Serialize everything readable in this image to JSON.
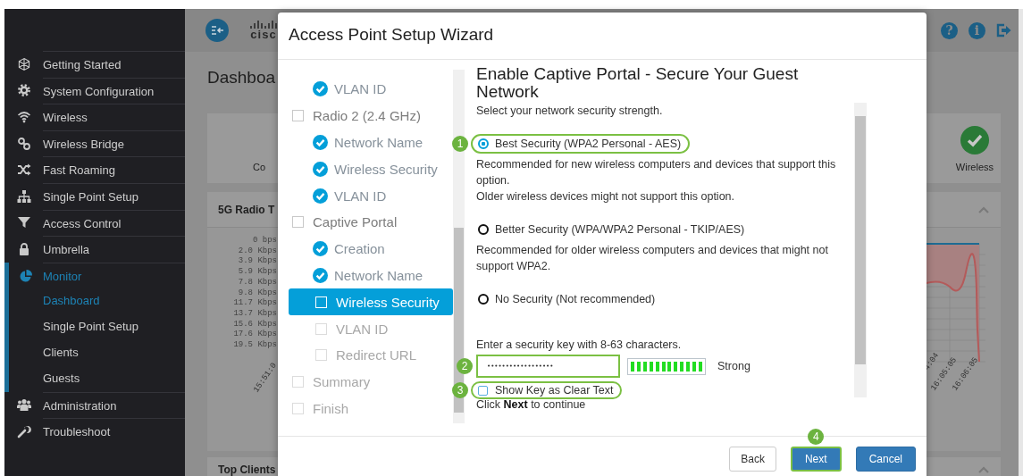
{
  "header": {
    "logo_text": "cisc",
    "help_icon": "?",
    "info_icon": "i"
  },
  "sidebar": {
    "items": [
      {
        "label": "Getting Started",
        "selected": false,
        "expanded": false
      },
      {
        "label": "System Configuration",
        "selected": false,
        "expanded": false
      },
      {
        "label": "Wireless",
        "selected": false,
        "expanded": false
      },
      {
        "label": "Wireless Bridge",
        "selected": false,
        "expanded": false
      },
      {
        "label": "Fast Roaming",
        "selected": false,
        "expanded": false
      },
      {
        "label": "Single Point Setup",
        "selected": false,
        "expanded": false
      },
      {
        "label": "Access Control",
        "selected": false,
        "expanded": false
      },
      {
        "label": "Umbrella",
        "selected": false,
        "expanded": false
      },
      {
        "label": "Monitor",
        "selected": true,
        "expanded": true,
        "children": [
          {
            "label": "Dashboard",
            "selected": true
          },
          {
            "label": "Single Point Setup",
            "selected": false
          },
          {
            "label": "Clients",
            "selected": false
          },
          {
            "label": "Guests",
            "selected": false
          }
        ]
      },
      {
        "label": "Administration",
        "selected": false,
        "expanded": false
      },
      {
        "label": "Troubleshoot",
        "selected": false,
        "expanded": false
      }
    ]
  },
  "page": {
    "title": "Dashboa",
    "status_cards": [
      {
        "label": "Co"
      },
      {
        "label": "Wireless",
        "ok": true
      }
    ],
    "panels": [
      {
        "title": "5G Radio T",
        "y_labels": [
          "0 bps",
          "2.0 Kbps",
          "3.9 Kbps",
          "5.9 Kbps",
          "7.8 Kbps",
          "9.8 Kbps",
          "11.7 Kbps",
          "13.7 Kbps",
          "15.6 Kbps",
          "17.6 Kbps",
          "19.5 Kbps"
        ],
        "x_labels": [
          "15:51:0",
          "4:04",
          "16:05:05",
          "16:06:05"
        ]
      },
      {
        "title": "Top Clients"
      }
    ]
  },
  "wizard": {
    "title": "Access Point Setup Wizard",
    "steps": [
      {
        "children": [
          {
            "label": "VLAN ID",
            "done": true,
            "selected": false,
            "disabled": false
          }
        ]
      },
      {
        "label": "Radio 2 (2.4 GHz)",
        "done": false,
        "selected": false,
        "disabled": false,
        "children": [
          {
            "label": "Network Name",
            "done": true,
            "selected": false,
            "disabled": false
          },
          {
            "label": "Wireless Security",
            "done": true,
            "selected": false,
            "disabled": false
          },
          {
            "label": "VLAN ID",
            "done": true,
            "selected": false,
            "disabled": false
          }
        ]
      },
      {
        "label": "Captive Portal",
        "done": false,
        "selected": false,
        "disabled": false,
        "children": [
          {
            "label": "Creation",
            "done": true,
            "selected": false,
            "disabled": false
          },
          {
            "label": "Network Name",
            "done": true,
            "selected": false,
            "disabled": false
          },
          {
            "label": "Wireless Security",
            "done": false,
            "selected": true,
            "disabled": false
          },
          {
            "label": "VLAN ID",
            "done": false,
            "selected": false,
            "disabled": true
          },
          {
            "label": "Redirect URL",
            "done": false,
            "selected": false,
            "disabled": true
          }
        ]
      },
      {
        "label": "Summary",
        "done": false,
        "selected": false,
        "disabled": true
      },
      {
        "label": "Finish",
        "done": false,
        "selected": false,
        "disabled": true
      }
    ],
    "heading": "Enable Captive Portal - Secure Your Guest Network",
    "intro": "Select your network security strength.",
    "options": [
      {
        "label": "Best Security (WPA2 Personal - AES)",
        "selected": true,
        "callout": "1",
        "description": [
          "Recommended for new wireless computers and devices that support this option.",
          "Older wireless devices might not support this option."
        ]
      },
      {
        "label": "Better Security (WPA/WPA2 Personal - TKIP/AES)",
        "selected": false,
        "description": [
          "Recommended for older wireless computers and devices that might not support WPA2."
        ]
      },
      {
        "label": "No Security (Not recommended)",
        "selected": false
      }
    ],
    "key_prompt": "Enter a security key with 8-63 characters.",
    "key_field": {
      "value": "••••••••••••••••••",
      "callout": "2"
    },
    "strength": {
      "level": 1,
      "reading": "Strong"
    },
    "show_key": {
      "label": "Show Key as Clear Text",
      "checked": false,
      "callout": "3"
    },
    "hint": "Click **Next** to continue",
    "buttons": [
      {
        "label": "Back",
        "kind": "default"
      },
      {
        "label": "Next",
        "kind": "primary",
        "callout": "4"
      },
      {
        "label": "Cancel",
        "kind": "primary"
      }
    ]
  }
}
